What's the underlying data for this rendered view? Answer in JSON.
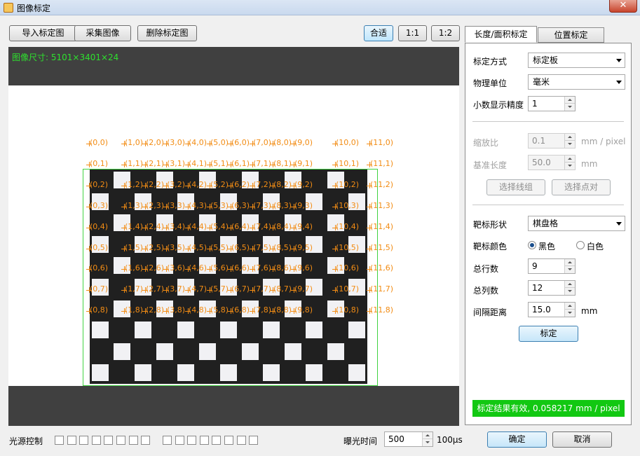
{
  "window": {
    "title": "图像标定",
    "close_label": "✕"
  },
  "toolbar": {
    "import_label": "导入标定图",
    "capture_label": "采集图像",
    "delete_label": "删除标定图",
    "zoom_fit_label": "合适",
    "zoom_1_1_label": "1:1",
    "zoom_1_2_label": "1:2"
  },
  "image_view": {
    "size_text": "图像尺寸: 5101×3401×24",
    "colors": {
      "overlay_text": "#2ee02e",
      "corner_label": "#f28c14",
      "roi_border": "#41d341"
    },
    "corner_rows": [
      [
        "(0,0)",
        "(1,0)",
        "(2,0)",
        "(3,0)",
        "(4,0)",
        "(5,0)",
        "(6,0)",
        "(7,0)",
        "(8,0)",
        "(9,0)",
        "(10,0)",
        "(11,0)"
      ],
      [
        "(0,1)",
        "(1,1)",
        "(2,1)",
        "(3,1)",
        "(4,1)",
        "(5,1)",
        "(6,1)",
        "(7,1)",
        "(8,1)",
        "(9,1)",
        "(10,1)",
        "(11,1)"
      ],
      [
        "(0,2)",
        "(1,2)",
        "(2,2)",
        "(3,2)",
        "(4,2)",
        "(5,2)",
        "(6,2)",
        "(7,2)",
        "(8,2)",
        "(9,2)",
        "(10,2)",
        "(11,2)"
      ],
      [
        "(0,3)",
        "(1,3)",
        "(2,3)",
        "(3,3)",
        "(4,3)",
        "(5,3)",
        "(6,3)",
        "(7,3)",
        "(8,3)",
        "(9,3)",
        "(10,3)",
        "(11,3)"
      ],
      [
        "(0,4)",
        "(1,4)",
        "(2,4)",
        "(3,4)",
        "(4,4)",
        "(5,4)",
        "(6,4)",
        "(7,4)",
        "(8,4)",
        "(9,4)",
        "(10,4)",
        "(11,4)"
      ],
      [
        "(0,5)",
        "(1,5)",
        "(2,5)",
        "(3,5)",
        "(4,5)",
        "(5,5)",
        "(6,5)",
        "(7,5)",
        "(8,5)",
        "(9,5)",
        "(10,5)",
        "(11,5)"
      ],
      [
        "(0,6)",
        "(1,6)",
        "(2,6)",
        "(3,6)",
        "(4,6)",
        "(5,6)",
        "(6,6)",
        "(7,6)",
        "(8,6)",
        "(9,6)",
        "(10,6)",
        "(11,6)"
      ],
      [
        "(0,7)",
        "(1,7)",
        "(2,7)",
        "(3,7)",
        "(4,7)",
        "(5,7)",
        "(6,7)",
        "(7,7)",
        "(8,7)",
        "(9,7)",
        "(10,7)",
        "(11,7)"
      ],
      [
        "(0,8)",
        "(1,8)",
        "(2,8)",
        "(3,8)",
        "(4,8)",
        "(5,8)",
        "(6,8)",
        "(7,8)",
        "(8,8)",
        "(9,8)",
        "(10,8)",
        "(11,8)"
      ]
    ]
  },
  "tabs": {
    "length_area_label": "长度/面积标定",
    "position_label": "位置标定"
  },
  "calibration": {
    "method_label": "标定方式",
    "method_value": "标定板",
    "unit_label": "物理单位",
    "unit_value": "毫米",
    "precision_label": "小数显示精度",
    "precision_value": "1",
    "scale_label": "缩放比",
    "scale_value": "0.1",
    "scale_unit": "mm / pixel",
    "base_length_label": "基准长度",
    "base_length_value": "50.0",
    "base_length_unit": "mm",
    "select_line_label": "选择线组",
    "select_points_label": "选择点对",
    "target_shape_label": "靶标形状",
    "target_shape_value": "棋盘格",
    "target_color_label": "靶标颜色",
    "color_black_label": "黑色",
    "color_white_label": "白色",
    "rows_label": "总行数",
    "rows_value": "9",
    "cols_label": "总列数",
    "cols_value": "12",
    "spacing_label": "间隔距离",
    "spacing_value": "15.0",
    "spacing_unit": "mm",
    "calibrate_label": "标定",
    "result_text": "标定结果有效, 0.058217 mm / pixel",
    "result_color": "#12c812"
  },
  "bottom": {
    "light_label": "光源控制",
    "exposure_label": "曝光时间",
    "exposure_value": "500",
    "exposure_unit": "100μs",
    "ok_label": "确定",
    "cancel_label": "取消"
  }
}
